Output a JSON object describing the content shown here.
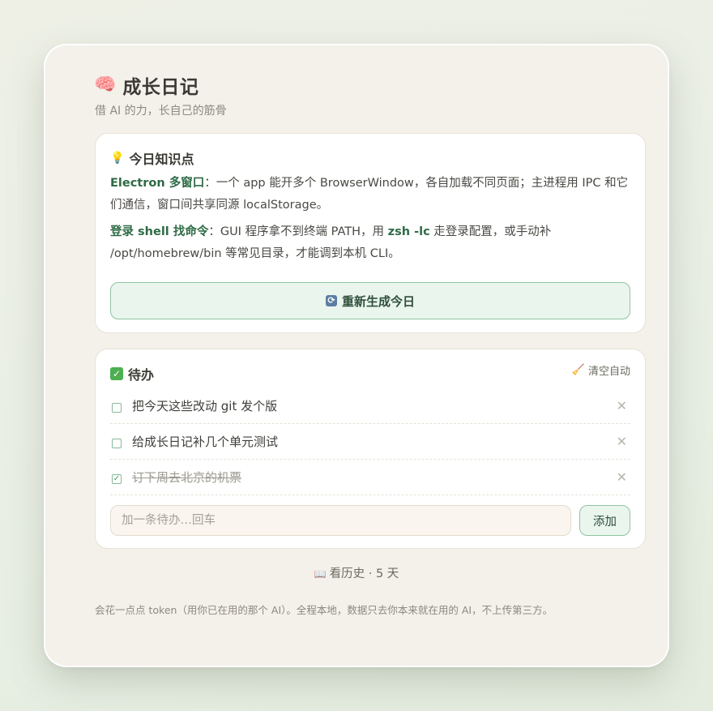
{
  "app": {
    "title_emoji": "🧠",
    "title": "成长日记",
    "subtitle": "借 AI 的力，长自己的筋骨"
  },
  "knowledge": {
    "icon": "bulb-icon",
    "heading": "今日知识点",
    "items": [
      {
        "term": "Electron 多窗口",
        "sep": "：",
        "body": "一个 app 能开多个 BrowserWindow，各自加载不同页面；主进程用 IPC 和它们通信，窗口间共享同源 localStorage。"
      },
      {
        "term": "登录 shell 找命令",
        "sep": "：",
        "body_a": "GUI 程序拿不到终端 PATH，用 ",
        "code": "zsh -lc",
        "body_b": " 走登录配置，或手动补 /opt/homebrew/bin 等常见目录，才能调到本机 CLI。"
      }
    ],
    "regen_label": "重新生成今日"
  },
  "todo": {
    "heading": "待办",
    "clear_label": "清空自动",
    "items": [
      {
        "text": "把今天这些改动 git 发个版",
        "done": false
      },
      {
        "text": "给成长日记补几个单元测试",
        "done": false
      },
      {
        "text": "订下周去北京的机票",
        "done": true
      }
    ],
    "input_placeholder": "加一条待办…回车",
    "add_label": "添加"
  },
  "history": {
    "label": "看历史 · 5 天"
  },
  "footnote": "会花一点点 token（用你已在用的那个 AI）。全程本地，数据只去你本来就在用的 AI，不上传第三方。",
  "colors": {
    "accent_green": "#2e6b46",
    "button_bg": "#eaf5ee",
    "button_border": "#8fc4a0",
    "window_bg": "#f4f0ea"
  }
}
